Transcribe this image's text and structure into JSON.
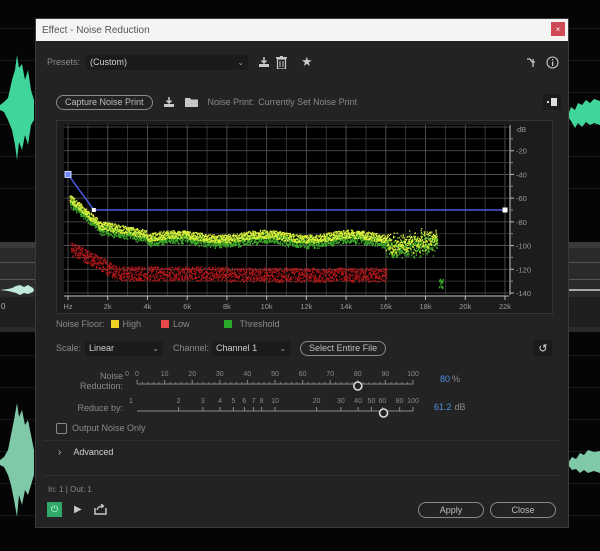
{
  "window": {
    "title": "Effect - Noise Reduction",
    "close_label": "×"
  },
  "presets": {
    "label": "Presets:",
    "value": "(Custom)",
    "icons": [
      "download-preset-icon",
      "trash-icon",
      "star-icon"
    ],
    "right_icons": [
      "routing-icon",
      "info-icon"
    ]
  },
  "noise_print": {
    "capture_label": "Capture Noise Print",
    "label": "Noise Print:",
    "value": "Currently Set Noise Print"
  },
  "graph": {
    "x_ticks": [
      "Hz",
      "2k",
      "4k",
      "6k",
      "8k",
      "10k",
      "12k",
      "14k",
      "16k",
      "18k",
      "20k",
      "22k"
    ],
    "y_unit": "dB",
    "y_ticks": [
      "-20",
      "-40",
      "-60",
      "-80",
      "-100",
      "-120",
      "-140"
    ],
    "threshold_curve_db": [
      [
        0,
        -40
      ],
      [
        1300,
        -70
      ],
      [
        22000,
        -70
      ]
    ]
  },
  "legend": {
    "label": "Noise Floor:",
    "items": [
      {
        "label": "High",
        "color": "#f0d020"
      },
      {
        "label": "Low",
        "color": "#e84a4a"
      },
      {
        "label": "Threshold",
        "color": "#2aa82a"
      }
    ]
  },
  "controls": {
    "scale_label": "Scale:",
    "scale_value": "Linear",
    "channel_label": "Channel:",
    "channel_value": "Channel 1",
    "select_entire_label": "Select Entire File"
  },
  "noise_reduction": {
    "label": "Noise Reduction:",
    "min_label": "0",
    "ticks": [
      "0",
      "10",
      "20",
      "30",
      "40",
      "50",
      "60",
      "70",
      "80",
      "90",
      "100"
    ],
    "value": 80,
    "value_text": "80",
    "unit": "%"
  },
  "reduce_by": {
    "label": "Reduce by:",
    "min_label": "1",
    "ticks": [
      "2",
      "3",
      "4",
      "5",
      "6",
      "7",
      "8",
      "10",
      "20",
      "30",
      "40",
      "50",
      "60",
      "80",
      "100"
    ],
    "value": 61.2,
    "value_text": "61.2",
    "unit": "dB"
  },
  "output_noise_only": {
    "label": "Output Noise Only",
    "checked": false
  },
  "advanced": {
    "label": "Advanced",
    "expanded": false
  },
  "footer": {
    "io_text": "In: 1 | Out: 1",
    "apply_label": "Apply",
    "close_label": "Close"
  },
  "background": {
    "track_label": "0"
  }
}
